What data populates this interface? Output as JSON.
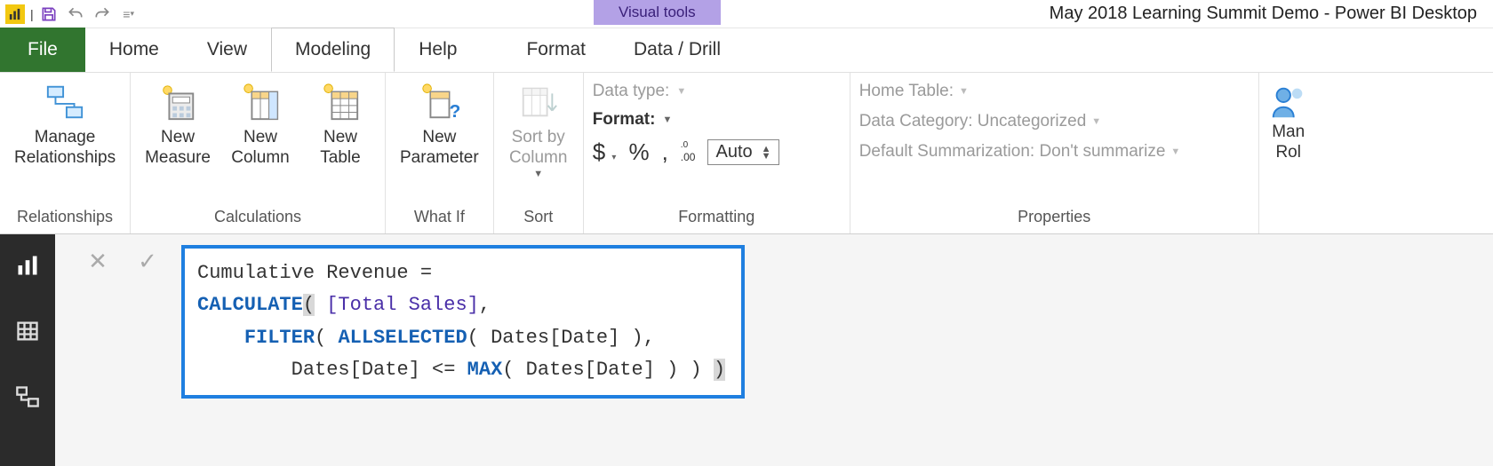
{
  "titlebar": {
    "context_tab": "Visual tools",
    "doc_title": "May 2018 Learning Summit Demo - Power BI Desktop"
  },
  "tabs": {
    "file": "File",
    "home": "Home",
    "view": "View",
    "modeling": "Modeling",
    "help": "Help",
    "format": "Format",
    "data_drill": "Data / Drill"
  },
  "ribbon": {
    "relationships": {
      "manage": "Manage\nRelationships",
      "group": "Relationships"
    },
    "calculations": {
      "new_measure": "New\nMeasure",
      "new_column": "New\nColumn",
      "new_table": "New\nTable",
      "group": "Calculations"
    },
    "whatif": {
      "new_parameter": "New\nParameter",
      "group": "What If"
    },
    "sort": {
      "sort_by_column": "Sort by\nColumn",
      "group": "Sort"
    },
    "formatting": {
      "data_type": "Data type:",
      "format": "Format:",
      "dollar": "$",
      "percent": "%",
      "comma": ",",
      "decimals_icon": ".00",
      "auto": "Auto",
      "group": "Formatting"
    },
    "properties": {
      "home_table": "Home Table:",
      "data_category": "Data Category: Uncategorized",
      "default_summarization": "Default Summarization: Don't summarize",
      "group": "Properties"
    },
    "security": {
      "manage_roles": "Man\nRol"
    }
  },
  "formula": {
    "line1_plain": "Cumulative Revenue =",
    "line2_kw": "CALCULATE",
    "line2_meas": "[Total Sales]",
    "line2_rest": ",",
    "line3_indent": "    ",
    "line3_kw1": "FILTER",
    "line3_mid": "( ",
    "line3_kw2": "ALLSELECTED",
    "line3_rest": "( Dates[Date] ),",
    "line4_indent": "        ",
    "line4_pre": "Dates[Date] <= ",
    "line4_kw": "MAX",
    "line4_rest": "( Dates[Date] ) ) "
  }
}
